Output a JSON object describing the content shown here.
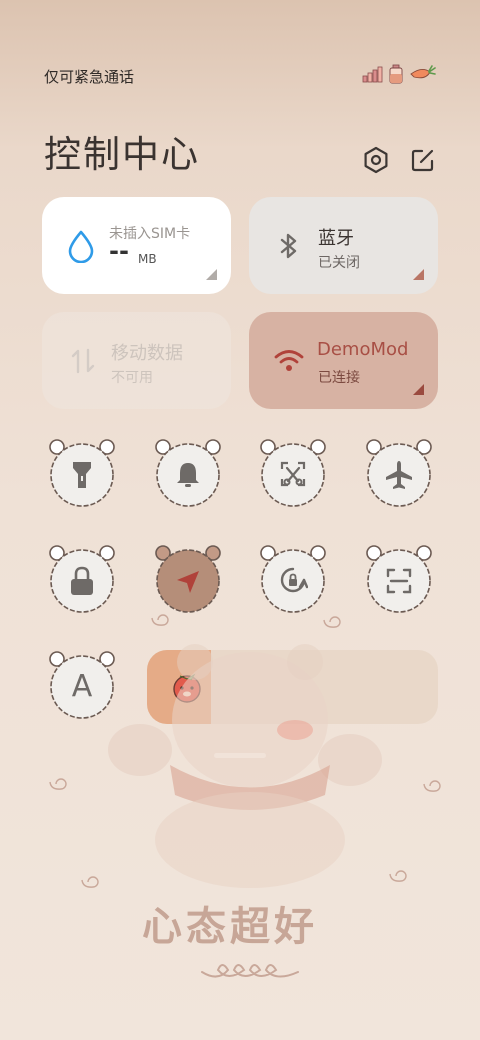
{
  "status_bar": {
    "carrier_text": "仅可紧急通话",
    "icons": [
      "signal-bars-icon",
      "battery-bottle-icon",
      "carrot-icon"
    ]
  },
  "header": {
    "title": "控制中心",
    "settings_icon": "hexagon-gear-icon",
    "edit_icon": "edit-icon"
  },
  "tiles": {
    "data_usage": {
      "title": "未插入SIM卡",
      "value": "--",
      "unit": "MB",
      "icon": "drop-icon"
    },
    "bluetooth": {
      "title": "蓝牙",
      "status": "已关闭",
      "icon": "bluetooth-icon"
    },
    "mobile_data": {
      "title": "移动数据",
      "status": "不可用",
      "icon": "arrows-updown-icon"
    },
    "wifi": {
      "title": "DemoMod",
      "status": "已连接",
      "icon": "wifi-icon"
    }
  },
  "toggles": [
    {
      "name": "flashlight",
      "icon": "flashlight-icon",
      "active": false
    },
    {
      "name": "notifications",
      "icon": "bell-icon",
      "active": false
    },
    {
      "name": "screenshot",
      "icon": "scissors-screenshot-icon",
      "active": false
    },
    {
      "name": "airplane",
      "icon": "airplane-icon",
      "active": false
    },
    {
      "name": "lock-screen",
      "icon": "lock-icon",
      "active": false
    },
    {
      "name": "location",
      "icon": "location-arrow-icon",
      "active": true
    },
    {
      "name": "rotation-lock",
      "icon": "rotation-lock-icon",
      "active": false
    },
    {
      "name": "scanner",
      "icon": "scan-icon",
      "active": false
    },
    {
      "name": "auto-brightness",
      "icon": "letter-a-icon",
      "active": false
    }
  ],
  "toggle_a_glyph": "A",
  "brightness": {
    "level": 0.22,
    "icon": "tomato-face-icon"
  },
  "colors": {
    "accent": "#b97565",
    "wifi_tile_bg": "#d7b2a3",
    "card_white": "#ffffff",
    "card_gray": "#e8e5e2",
    "icon_gray": "#6e6a67",
    "drop_blue": "#2f9be8",
    "brightness_fill": "#e5ab87"
  },
  "wallpaper": {
    "slogan": "心态超好"
  }
}
